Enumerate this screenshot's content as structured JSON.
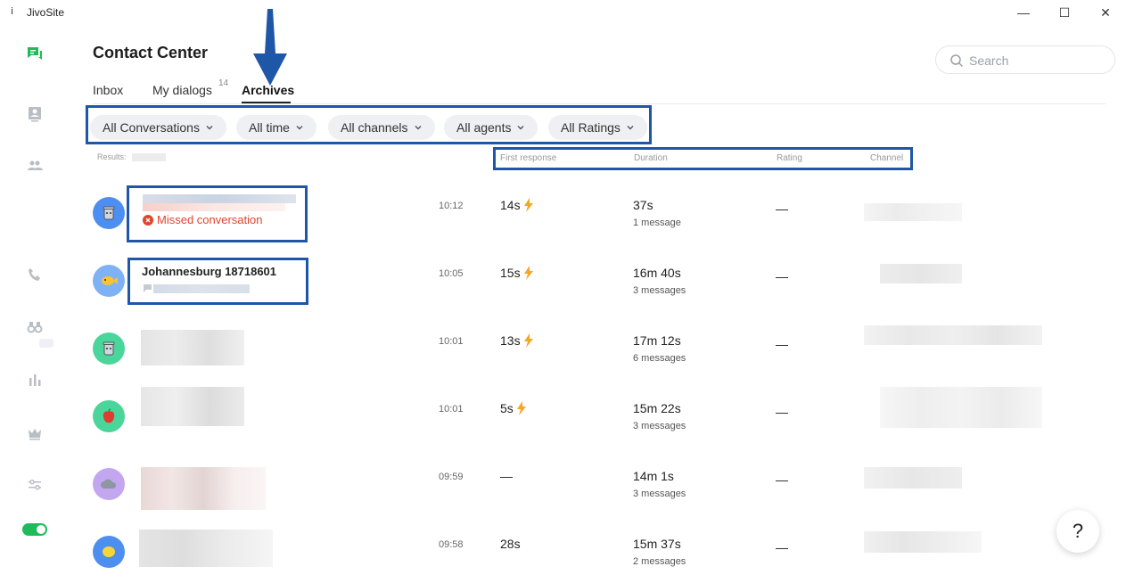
{
  "window": {
    "title": "JivoSite",
    "minimize": "—",
    "maximize": "☐",
    "close": "✕"
  },
  "header": {
    "title": "Contact Center",
    "tabs": [
      {
        "label": "Inbox"
      },
      {
        "label": "My dialogs",
        "badge": "14"
      },
      {
        "label": "Archives"
      }
    ]
  },
  "search": {
    "placeholder": "Search"
  },
  "filters": [
    {
      "label": "All Conversations"
    },
    {
      "label": "All time"
    },
    {
      "label": "All channels"
    },
    {
      "label": "All agents"
    },
    {
      "label": "All Ratings"
    }
  ],
  "results_label": "Results:",
  "columns": {
    "first_response": "First response",
    "duration": "Duration",
    "rating": "Rating",
    "channel": "Channel"
  },
  "rows": [
    {
      "name": "",
      "status": "Missed conversation",
      "time": "10:12",
      "first_response": "14s",
      "fast": true,
      "duration": "37s",
      "messages": "1 message",
      "rating": "—",
      "avatar_color": "#4d8ff0",
      "avatar_icon": "trash-can-icon"
    },
    {
      "name": "Johannesburg 18718601",
      "status": "",
      "time": "10:05",
      "first_response": "15s",
      "fast": true,
      "duration": "16m 40s",
      "messages": "3 messages",
      "rating": "—",
      "avatar_color": "#7fb2f5",
      "avatar_icon": "fish-icon"
    },
    {
      "name": "",
      "status": "",
      "time": "10:01",
      "first_response": "13s",
      "fast": true,
      "duration": "17m 12s",
      "messages": "6 messages",
      "rating": "—",
      "avatar_color": "#4ad59a",
      "avatar_icon": "trash-can-icon"
    },
    {
      "name": "",
      "status": "",
      "time": "10:01",
      "first_response": "5s",
      "fast": true,
      "duration": "15m 22s",
      "messages": "3 messages",
      "rating": "—",
      "avatar_color": "#4ad59a",
      "avatar_icon": "apple-icon"
    },
    {
      "name": "",
      "status": "",
      "time": "09:59",
      "first_response": "—",
      "fast": false,
      "duration": "14m 1s",
      "messages": "3 messages",
      "rating": "—",
      "avatar_color": "#c3a6f0",
      "avatar_icon": "cloud-icon"
    },
    {
      "name": "",
      "status": "",
      "time": "09:58",
      "first_response": "28s",
      "fast": false,
      "duration": "15m 37s",
      "messages": "2 messages",
      "rating": "—",
      "avatar_color": "#4d8ff0",
      "avatar_icon": "lemon-icon"
    }
  ],
  "help_label": "?",
  "colors": {
    "accent_green": "#1fbb5a",
    "annotation_blue": "#1e57a8",
    "missed_red": "#e0452c",
    "bolt_orange": "#f5a623"
  }
}
